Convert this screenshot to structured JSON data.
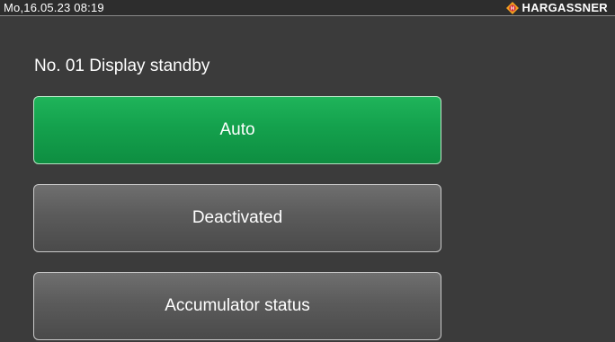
{
  "statusbar": {
    "datetime": "Mo,16.05.23 08:19",
    "brand": "HARGASSNER",
    "brand_logo_icon": "hargassner-logo-icon",
    "brand_color": "#f0a020"
  },
  "page": {
    "title": "No. 01 Display standby"
  },
  "options": [
    {
      "label": "Auto",
      "selected": true
    },
    {
      "label": "Deactivated",
      "selected": false
    },
    {
      "label": "Accumulator status",
      "selected": false
    }
  ],
  "colors": {
    "background": "#3b3b3b",
    "selected": "#14a14d",
    "unselected": "#5b5b5b"
  }
}
